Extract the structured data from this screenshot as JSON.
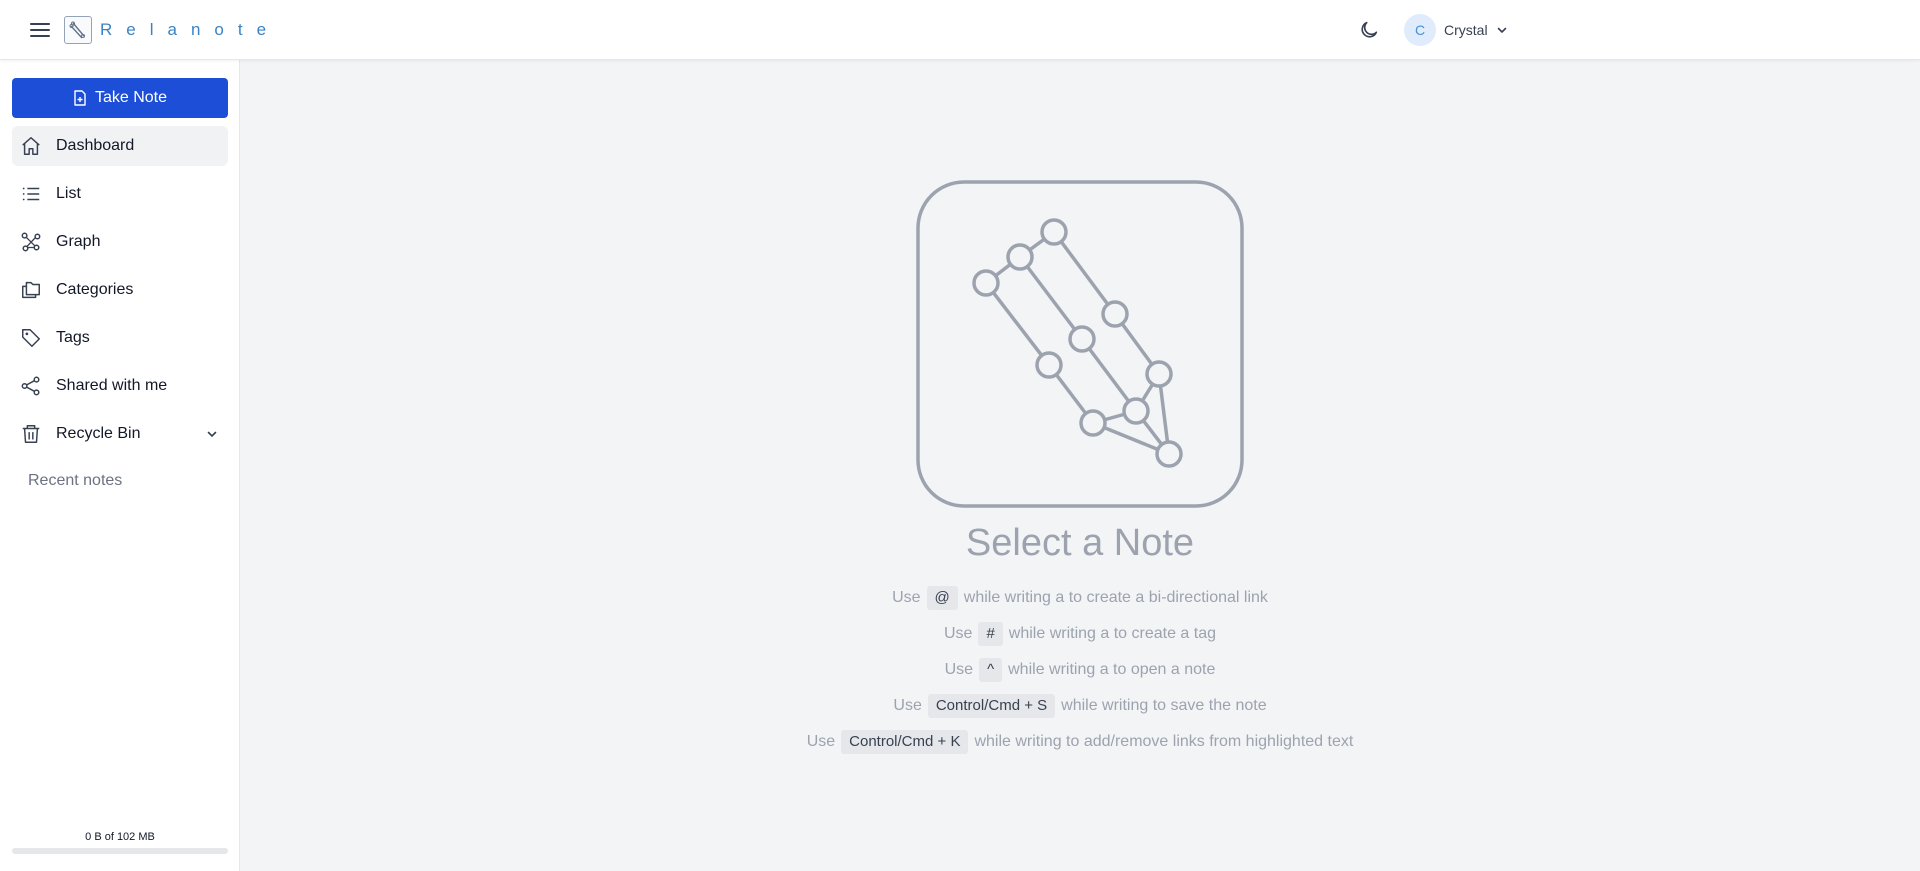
{
  "app": {
    "brand_name": "Relanote",
    "brand_color": "#3b82c4",
    "accent_color": "#1d4ed8"
  },
  "header": {
    "menu_icon": "hamburger-menu-icon",
    "theme_icon": "moon-icon",
    "user": {
      "initial": "C",
      "name": "Crystal",
      "chevron_icon": "chevron-down-icon"
    }
  },
  "sidebar": {
    "take_note": {
      "label": "Take Note",
      "icon": "file-plus-icon"
    },
    "items": [
      {
        "label": "Dashboard",
        "icon": "home-icon",
        "active": true
      },
      {
        "label": "List",
        "icon": "list-icon"
      },
      {
        "label": "Graph",
        "icon": "graph-icon"
      },
      {
        "label": "Categories",
        "icon": "folders-icon"
      },
      {
        "label": "Tags",
        "icon": "tag-icon"
      },
      {
        "label": "Shared with me",
        "icon": "share-icon"
      },
      {
        "label": "Recycle Bin",
        "icon": "trash-icon",
        "expandable": true
      }
    ],
    "recent_notes_label": "Recent notes",
    "storage": {
      "text": "0 B of 102 MB",
      "used_fraction": 0
    }
  },
  "main": {
    "title": "Select a Note",
    "hints": [
      {
        "before": "Use",
        "key": "@",
        "after": "while writing a to create a bi-directional link"
      },
      {
        "before": "Use",
        "key": "#",
        "after": "while writing a to create a tag"
      },
      {
        "before": "Use",
        "key": "^",
        "after": "while writing a to open a note"
      },
      {
        "before": "Use",
        "key": "Control/Cmd + S",
        "after": "while writing to save the note"
      },
      {
        "before": "Use",
        "key": "Control/Cmd + K",
        "after": "while writing to add/remove links from highlighted text"
      }
    ]
  }
}
